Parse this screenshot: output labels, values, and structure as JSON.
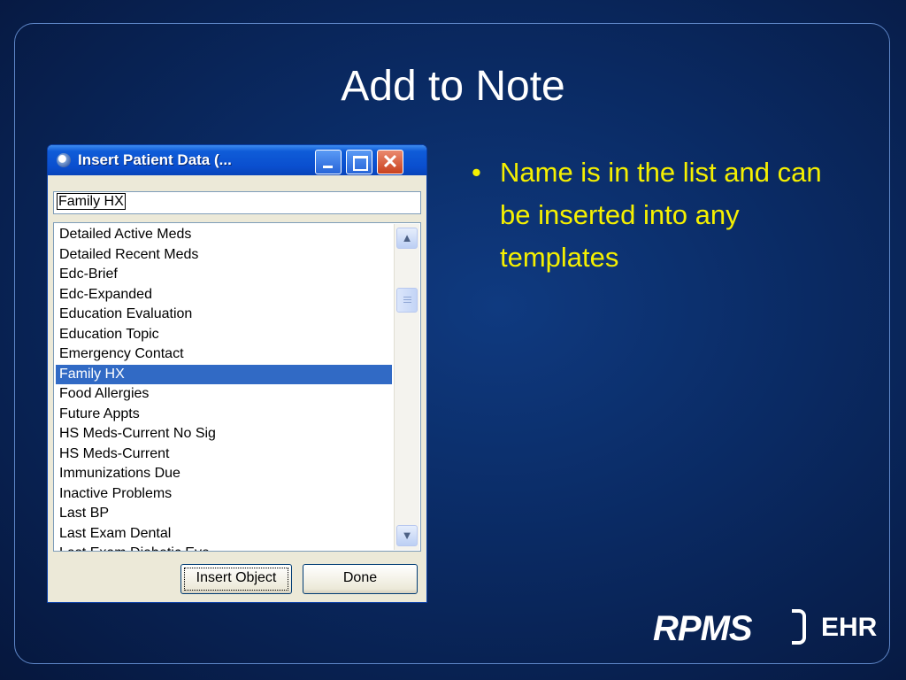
{
  "slide": {
    "title": "Add to Note",
    "bullet": "Name is in the list and can be inserted into any templates",
    "logo_main": "RPMS",
    "logo_sub": "EHR"
  },
  "dialog": {
    "title": "Insert Patient Data (...",
    "search_value": "Family HX",
    "items": [
      "Detailed Active Meds",
      "Detailed Recent Meds",
      "Edc-Brief",
      "Edc-Expanded",
      "Education Evaluation",
      "Education Topic",
      "Emergency Contact",
      "Family HX",
      "Food Allergies",
      "Future Appts",
      "HS Meds-Current No Sig",
      "HS Meds-Current",
      "Immunizations Due",
      "Inactive Problems",
      "Last BP",
      "Last Exam Dental",
      "Last Exam Diabetic Eye"
    ],
    "selected_index": 7,
    "insert_button": "Insert Object",
    "done_button": "Done"
  }
}
